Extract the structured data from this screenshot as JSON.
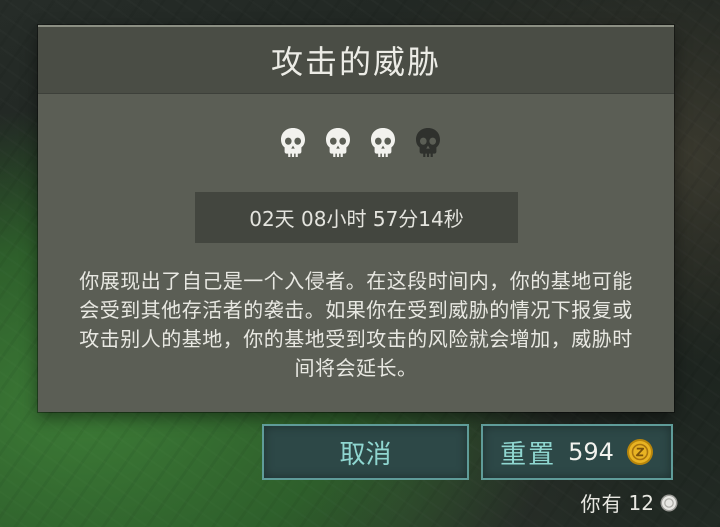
{
  "dialog": {
    "title": "攻击的威胁",
    "threat_level": {
      "active": 3,
      "total": 4
    },
    "timer": "02天 08小时 57分14秒",
    "description": "你展现出了自己是一个入侵者。在这段时间内，你的基地可能会受到其他存活者的袭击。如果你在受到威胁的情况下报复或攻击别人的基地，你的基地受到攻击的风险就会增加，威胁时间将会延长。"
  },
  "buttons": {
    "cancel_label": "取消",
    "reset_label": "重置",
    "reset_cost": "594",
    "reset_cost_icon": "gold-coin-icon"
  },
  "wallet": {
    "owned_label": "你有",
    "owned_amount": "12",
    "owned_icon": "silver-coin-icon"
  },
  "colors": {
    "dialog_bg": "#5b5e55",
    "header_bg": "#4a4d45",
    "button_border": "#5f9c99",
    "button_text": "#8fd6d0",
    "gold": "#d9a520",
    "skull_active": "#f2f2ee",
    "skull_inactive": "#2f312d"
  }
}
